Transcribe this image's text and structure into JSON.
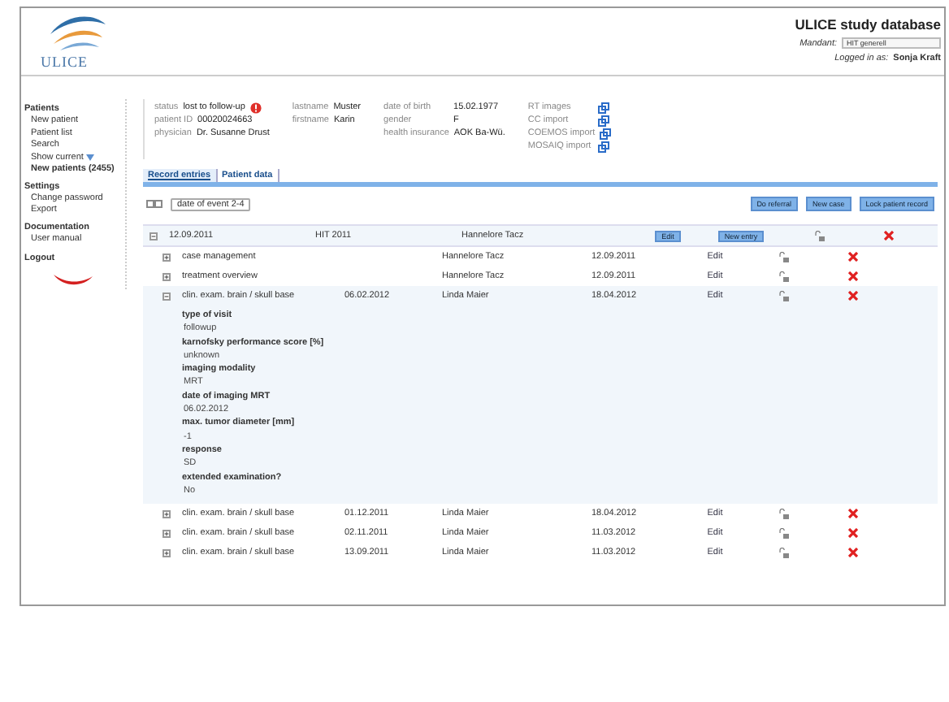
{
  "header": {
    "logo_text": "ULICE",
    "title": "ULICE study database",
    "mandant_label": "Mandant:",
    "mandant_value": "HIT generell",
    "logged_label": "Logged in as:",
    "logged_user": "Sonja Kraft"
  },
  "sidebar": [
    {
      "title": "Patients",
      "items": [
        {
          "label": "New patient",
          "bold": false,
          "caret": false
        },
        {
          "label": "Patient list",
          "bold": false,
          "caret": false
        },
        {
          "label": "Search",
          "bold": false,
          "caret": false
        },
        {
          "label": "Show current",
          "bold": false,
          "caret": true
        },
        {
          "label": "New patients (2455)",
          "bold": true,
          "caret": false
        }
      ]
    },
    {
      "title": "Settings",
      "items": [
        {
          "label": "Change password",
          "bold": false,
          "caret": false
        },
        {
          "label": "Export",
          "bold": false,
          "caret": false
        }
      ]
    },
    {
      "title": "Documentation",
      "items": [
        {
          "label": "User manual",
          "bold": false,
          "caret": false
        }
      ]
    }
  ],
  "logout": "Logout",
  "patient": {
    "col1": [
      {
        "label": "status",
        "value": "lost to follow-up",
        "alert": true
      },
      {
        "label": "patient ID",
        "value": "00020024663",
        "alert": false
      },
      {
        "label": "physician",
        "value": "Dr. Susanne Drust",
        "alert": false
      }
    ],
    "col2": [
      {
        "label": "lastname",
        "value": "Muster"
      },
      {
        "label": "firstname",
        "value": "Karin"
      }
    ],
    "col3": [
      {
        "label": "date of birth",
        "value": "15.02.1977"
      },
      {
        "label": "gender",
        "value": "F"
      },
      {
        "label": "health insurance",
        "value": "AOK Ba-Wü."
      }
    ],
    "links": [
      "RT images",
      "CC import",
      "COEMOS import",
      "MOSAIQ import"
    ]
  },
  "tabs": [
    {
      "label": "Record entries",
      "selected": true
    },
    {
      "label": "Patient data",
      "selected": false
    }
  ],
  "filter": "date of event 2-4",
  "actions": [
    "Do referral",
    "New case",
    "Lock patient record"
  ],
  "group": {
    "expanded": true,
    "date": "12.09.2011",
    "case": "HIT 2011",
    "person": "Hannelore Tacz",
    "edit": "Edit",
    "new_entry": "New entry"
  },
  "rows": [
    {
      "name": "case management",
      "date": "",
      "person": "Hannelore Tacz",
      "date2": "12.09.2011",
      "edit": "Edit",
      "expanded": false,
      "details": []
    },
    {
      "name": "treatment overview",
      "date": "",
      "person": "Hannelore Tacz",
      "date2": "12.09.2011",
      "edit": "Edit",
      "expanded": false,
      "details": []
    },
    {
      "name": "clin. exam. brain / skull base",
      "date": "06.02.2012",
      "person": "Linda Maier",
      "date2": "18.04.2012",
      "edit": "Edit",
      "expanded": true,
      "details": [
        {
          "label": "type of visit",
          "value": "followup"
        },
        {
          "label": "karnofsky performance score [%]",
          "value": "unknown"
        },
        {
          "label": "imaging modality",
          "value": "MRT"
        },
        {
          "label": "date of imaging MRT",
          "value": "06.02.2012"
        },
        {
          "label": "max. tumor diameter [mm]",
          "value": "-1"
        },
        {
          "label": "response",
          "value": "SD"
        },
        {
          "label": "extended examination?",
          "value": "No"
        }
      ]
    },
    {
      "name": "clin. exam. brain / skull base",
      "date": "01.12.2011",
      "person": "Linda Maier",
      "date2": "18.04.2012",
      "edit": "Edit",
      "expanded": false,
      "details": []
    },
    {
      "name": "clin. exam. brain / skull base",
      "date": "02.11.2011",
      "person": "Linda Maier",
      "date2": "11.03.2012",
      "edit": "Edit",
      "expanded": false,
      "details": []
    },
    {
      "name": "clin. exam. brain / skull base",
      "date": "13.09.2011",
      "person": "Linda Maier",
      "date2": "11.03.2012",
      "edit": "Edit",
      "expanded": false,
      "details": []
    }
  ]
}
